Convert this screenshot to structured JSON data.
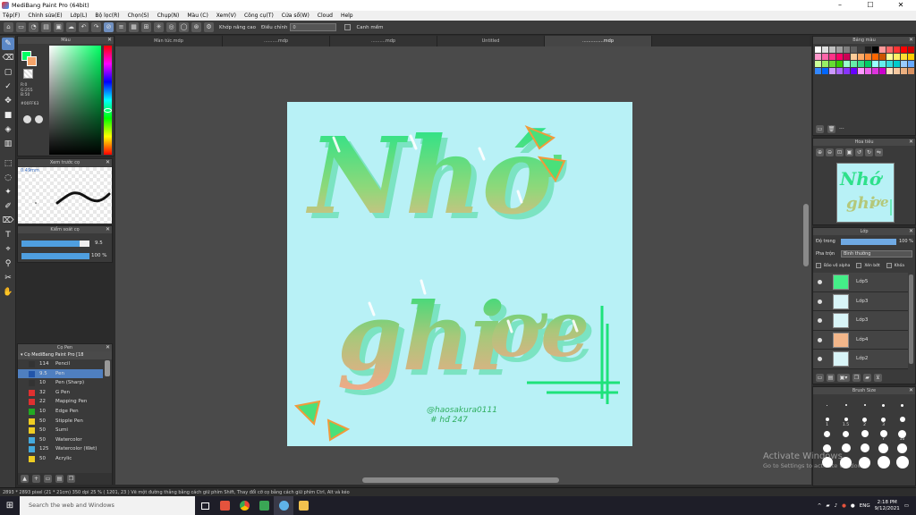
{
  "window": {
    "title": "MediBang Paint Pro (64bit)",
    "controls": [
      "–",
      "☐",
      "✕"
    ]
  },
  "menu": [
    "Tệp(F)",
    "Chỉnh sửa(E)",
    "Lớp(L)",
    "Bộ lọc(R)",
    "Chọn(S)",
    "Chụp(N)",
    "Màu (C)",
    "Xem(V)",
    "Công cụ(T)",
    "Cửa sổ(W)",
    "Cloud",
    "Help"
  ],
  "toolbar": {
    "snap_label": "Khớp nâng cao",
    "correction_label": "Điều chỉnh",
    "correction_value": "0",
    "anti_alias_label": "Canh mềm"
  },
  "tabs": [
    {
      "label": "Màn tức.mdp",
      "active": false
    },
    {
      "label": "..........mdp",
      "active": false
    },
    {
      "label": "..........mdp",
      "active": false
    },
    {
      "label": "Untitled",
      "active": false
    },
    {
      "label": "...............mdp",
      "active": true
    }
  ],
  "panels": {
    "color": {
      "title": "Màu",
      "rgb": [
        "R:0",
        "G:255",
        "B:50"
      ],
      "hex": "#00FF63"
    },
    "brush_preview": {
      "title": "Xem trước cọ",
      "size": "0.49mm"
    },
    "brush_control": {
      "title": "Kiểm soát cọ",
      "size_value": "9.5",
      "opacity_value": "100 %",
      "size_fraction": 0.85,
      "opacity_fraction": 1.0
    },
    "brushes": {
      "title": "Cọ Pen",
      "group": "Cọ MediBang Paint Pro [18",
      "items": [
        {
          "size": "114",
          "name": "Pencil",
          "color": "#333333"
        },
        {
          "size": "9.5",
          "name": "Pen",
          "color": "#2255aa",
          "selected": true
        },
        {
          "size": "10",
          "name": "Pen (Sharp)",
          "color": "#333333"
        },
        {
          "size": "32",
          "name": "G Pen",
          "color": "#e03030"
        },
        {
          "size": "22",
          "name": "Mapping Pen",
          "color": "#e03030"
        },
        {
          "size": "10",
          "name": "Edge Pen",
          "color": "#22aa22"
        },
        {
          "size": "50",
          "name": "Stipple Pen",
          "color": "#eecc22"
        },
        {
          "size": "50",
          "name": "Sumi",
          "color": "#eecc22"
        },
        {
          "size": "50",
          "name": "Watercolor",
          "color": "#44aadd"
        },
        {
          "size": "125",
          "name": "Watercolor (Wet)",
          "color": "#44aadd"
        },
        {
          "size": "50",
          "name": "Acrylic",
          "color": "#eecc22"
        }
      ]
    },
    "palette": {
      "title": "Bảng màu"
    },
    "navigator": {
      "title": "Hoa tiêu"
    },
    "layers": {
      "title": "Lớp",
      "opacity_label": "Độ trong",
      "opacity_value": "100 %",
      "blend_label": "Pha trộn",
      "blend_value": "Bình thường",
      "protect_alpha": "Bảo vệ alpha",
      "clipping": "Xén bớt",
      "lock": "Khóa",
      "items": [
        {
          "name": "Lớp5",
          "thumb": "#44ee88"
        },
        {
          "name": "Lớp3",
          "thumb": "#d9f5f8"
        },
        {
          "name": "Lớp3",
          "thumb": "#d9f5f8"
        },
        {
          "name": "Lớp4",
          "thumb": "#f2b68a"
        },
        {
          "name": "Lớp2",
          "thumb": "#d9f5f8"
        }
      ]
    },
    "brush_size": {
      "title": "Brush Size",
      "labels": [
        "",
        "",
        "",
        "",
        "",
        "1",
        "1.5",
        "2",
        "3",
        "",
        "",
        "",
        "",
        "7",
        "10",
        "",
        "",
        "",
        "",
        "",
        "",
        "",
        "",
        "",
        ""
      ]
    }
  },
  "artwork": {
    "line1": "Nhớ",
    "line2": "ghi",
    "line3": "ơe",
    "credit1": "@haosakura0111",
    "credit2": "# hđ 247"
  },
  "status_text": "2893 * 2893 pixel  (21 * 21cm)  350 dpi  25 %  ( 1201, 23 )  Vẽ một đường thẳng bằng cách giữ phím Shift, Thay đổi cỡ cọ bằng cách giữ phím Ctrl, Alt và kéo",
  "taskbar": {
    "search_placeholder": "Search the web and Windows",
    "lang": "ENG",
    "time": "2:18 PM",
    "date": "9/12/2021"
  },
  "watermark": {
    "line1": "Activate Windows",
    "line2": "Go to Settings to activate Windows."
  },
  "colors": {
    "ui_dark": "#2b2b2b",
    "panel": "#3a3a3a",
    "accent": "#4f7fc0",
    "canvas_bg": "#b8f1f6",
    "lettering_green": "#22e07a",
    "lettering_peach": "#f5b187"
  }
}
